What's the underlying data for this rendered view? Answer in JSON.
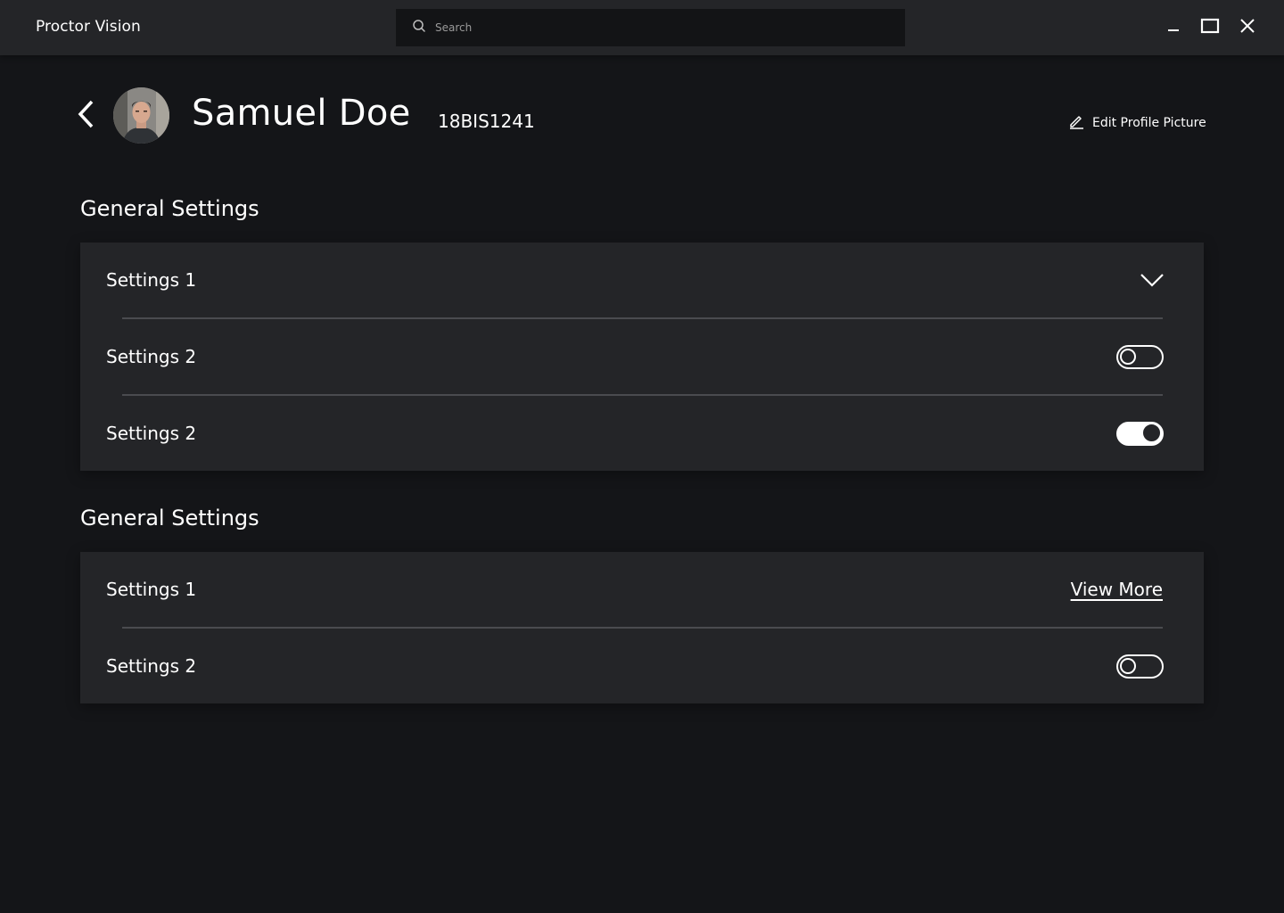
{
  "app": {
    "title": "Proctor Vision"
  },
  "search": {
    "placeholder": "Search",
    "value": "",
    "icon": "search-icon"
  },
  "window_controls": {
    "minimize": "minimize-icon",
    "maximize": "maximize-icon",
    "close": "close-icon"
  },
  "profile": {
    "name": "Samuel Doe",
    "id": "18BIS1241",
    "edit_label": "Edit Profile Picture",
    "back_icon": "chevron-left-icon"
  },
  "sections": [
    {
      "title": "General Settings",
      "rows": [
        {
          "label": "Settings 1",
          "control": "dropdown"
        },
        {
          "label": "Settings 2",
          "control": "toggle",
          "on": false
        },
        {
          "label": "Settings 2",
          "control": "toggle",
          "on": true
        }
      ]
    },
    {
      "title": "General Settings",
      "rows": [
        {
          "label": "Settings 1",
          "control": "link",
          "link_label": "View More"
        },
        {
          "label": "Settings 2",
          "control": "toggle",
          "on": false
        }
      ]
    }
  ],
  "colors": {
    "background": "#141518",
    "panel": "#242528",
    "titlebar": "#242528",
    "search_bg": "#131416",
    "divider": "#4a4b4f",
    "text": "#ffffff"
  }
}
